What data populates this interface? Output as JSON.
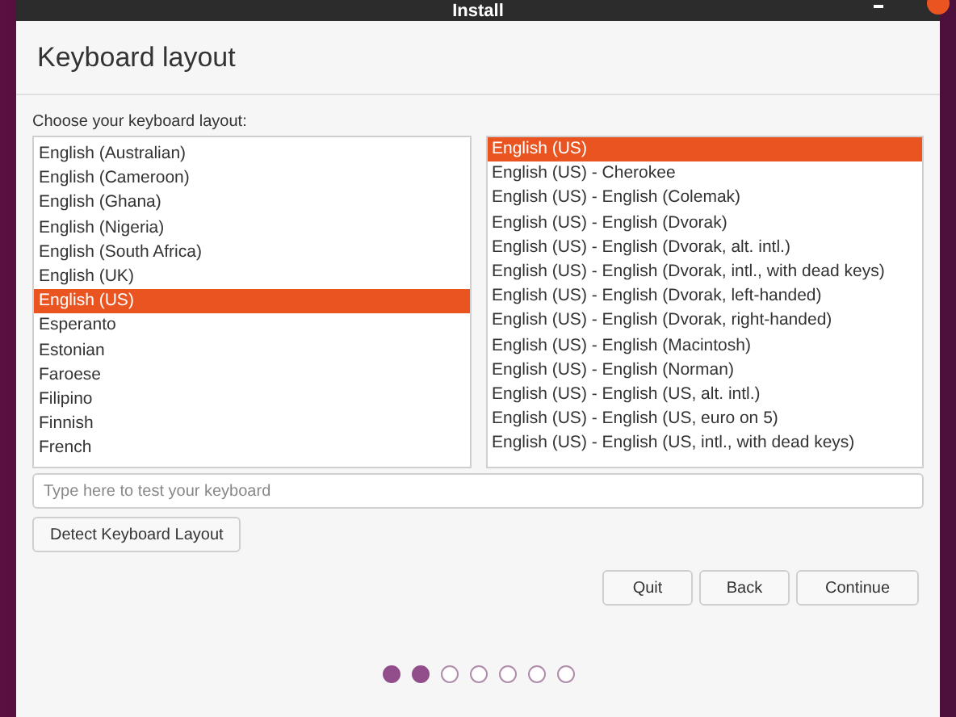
{
  "window": {
    "title": "Install"
  },
  "header": {
    "title": "Keyboard layout"
  },
  "prompt": "Choose your keyboard layout:",
  "layouts": [
    {
      "label": "English (Australian)",
      "selected": false
    },
    {
      "label": "English (Cameroon)",
      "selected": false
    },
    {
      "label": "English (Ghana)",
      "selected": false
    },
    {
      "label": "English (Nigeria)",
      "selected": false
    },
    {
      "label": "English (South Africa)",
      "selected": false
    },
    {
      "label": "English (UK)",
      "selected": false
    },
    {
      "label": "English (US)",
      "selected": true
    },
    {
      "label": "Esperanto",
      "selected": false
    },
    {
      "label": "Estonian",
      "selected": false
    },
    {
      "label": "Faroese",
      "selected": false
    },
    {
      "label": "Filipino",
      "selected": false
    },
    {
      "label": "Finnish",
      "selected": false
    },
    {
      "label": "French",
      "selected": false
    }
  ],
  "variants": [
    {
      "label": "English (US)",
      "selected": true
    },
    {
      "label": "English (US) - Cherokee",
      "selected": false
    },
    {
      "label": "English (US) - English (Colemak)",
      "selected": false
    },
    {
      "label": "English (US) - English (Dvorak)",
      "selected": false
    },
    {
      "label": "English (US) - English (Dvorak, alt. intl.)",
      "selected": false
    },
    {
      "label": "English (US) - English (Dvorak, intl., with dead keys)",
      "selected": false
    },
    {
      "label": "English (US) - English (Dvorak, left-handed)",
      "selected": false
    },
    {
      "label": "English (US) - English (Dvorak, right-handed)",
      "selected": false
    },
    {
      "label": "English (US) - English (Macintosh)",
      "selected": false
    },
    {
      "label": "English (US) - English (Norman)",
      "selected": false
    },
    {
      "label": "English (US) - English (US, alt. intl.)",
      "selected": false
    },
    {
      "label": "English (US) - English (US, euro on 5)",
      "selected": false
    },
    {
      "label": "English (US) - English (US, intl., with dead keys)",
      "selected": false
    }
  ],
  "test_field": {
    "placeholder": "Type here to test your keyboard"
  },
  "detect_button": "Detect Keyboard Layout",
  "buttons": [
    "Quit",
    "Back",
    "Continue"
  ],
  "steps": [
    {
      "done": true
    },
    {
      "done": true
    },
    {
      "done": false
    },
    {
      "done": false
    },
    {
      "done": false
    },
    {
      "done": false
    },
    {
      "done": false
    }
  ]
}
